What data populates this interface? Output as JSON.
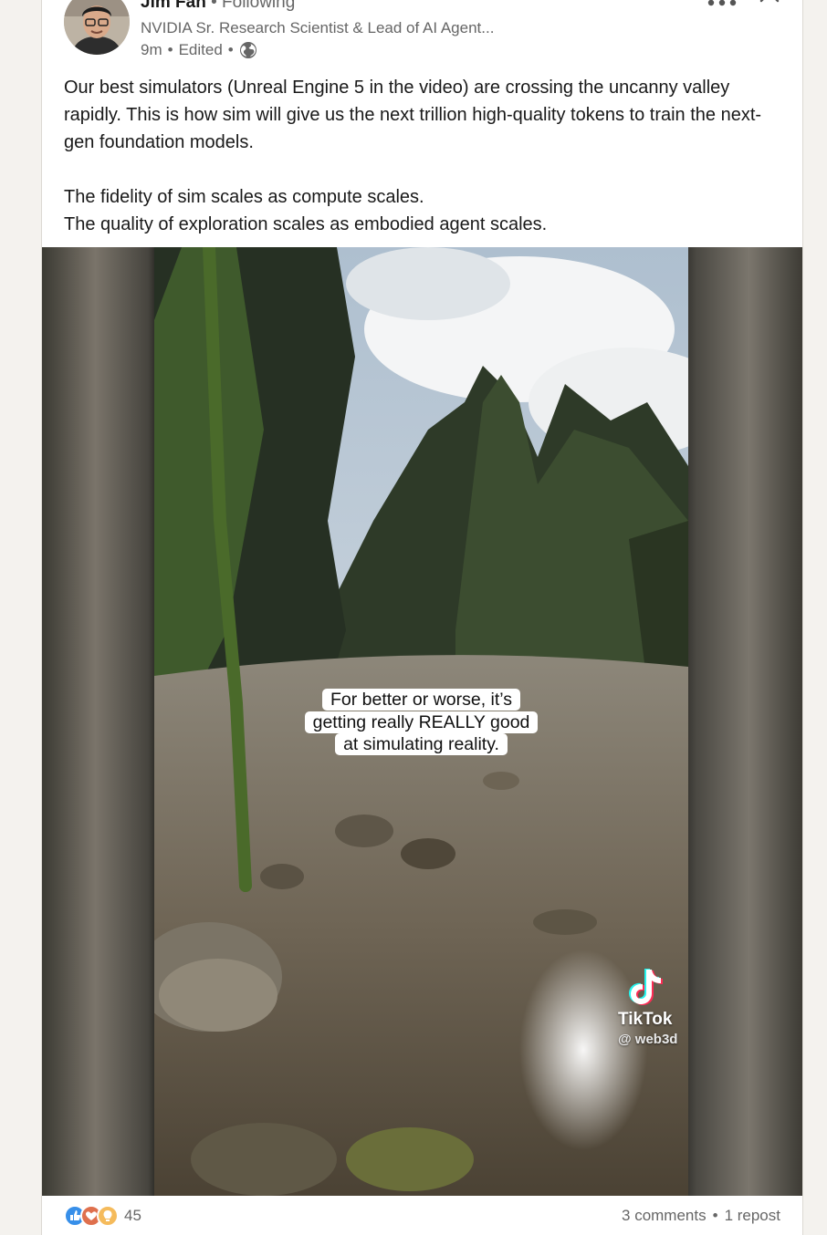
{
  "post": {
    "author_name": "Jim Fan",
    "separator": " • ",
    "follow_status": "Following",
    "headline": "NVIDIA Sr. Research Scientist & Lead of AI Agent...",
    "time": "9m",
    "edited": "Edited",
    "visibility_icon": "globe-icon",
    "paragraphs": [
      "Our best simulators (Unreal Engine 5 in the video) are crossing the uncanny valley rapidly. This is how sim will give us the next trillion high-quality tokens to train the next-gen foundation models.",
      "The fidelity of sim scales as compute scales.",
      "The quality of exploration scales as embodied agent scales."
    ]
  },
  "video": {
    "caption_lines": [
      "For better or worse, it’s",
      "getting really REALLY good",
      "at simulating reality."
    ],
    "watermark_name": "TikTok",
    "watermark_handle": "@ web3d"
  },
  "footer": {
    "reaction_icons": [
      "like-icon",
      "love-icon",
      "insightful-icon"
    ],
    "reaction_count": "45",
    "comments": "3 comments",
    "dot": "•",
    "reposts": "1 repost"
  },
  "colors": {
    "text_primary": "#191919",
    "text_secondary": "#666666",
    "like_blue": "#378fe9",
    "love_red": "#df704d",
    "insight_yellow": "#f5bb5c"
  }
}
